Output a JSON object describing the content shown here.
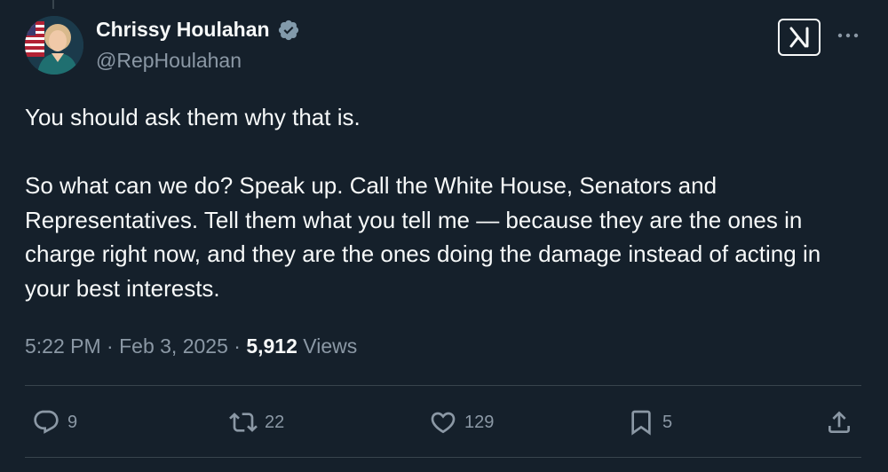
{
  "author": {
    "name": "Chrissy Houlahan",
    "handle": "@RepHoulahan"
  },
  "tweet": {
    "paragraphs": [
      "You should ask them why that is.",
      "So what can we do? Speak up. Call the White House, Senators and Representatives. Tell them what you tell me — because they are the ones in charge right now, and they are the ones doing the damage instead of acting in your best interests."
    ]
  },
  "meta": {
    "time": "5:22 PM",
    "separator": "·",
    "date": "Feb 3, 2025",
    "views_count": "5,912",
    "views_label": "Views"
  },
  "actions": {
    "replies": "9",
    "reposts": "22",
    "likes": "129",
    "bookmarks": "5"
  },
  "icons": {
    "verified": "verified-badge-icon",
    "grok": "grok-icon",
    "more": "more-icon",
    "reply": "reply-icon",
    "repost": "repost-icon",
    "like": "like-icon",
    "bookmark": "bookmark-icon",
    "share": "share-icon"
  },
  "colors": {
    "background": "#15202b",
    "text_primary": "#f7f9f9",
    "text_secondary": "#8b98a5",
    "divider": "#38444d"
  }
}
